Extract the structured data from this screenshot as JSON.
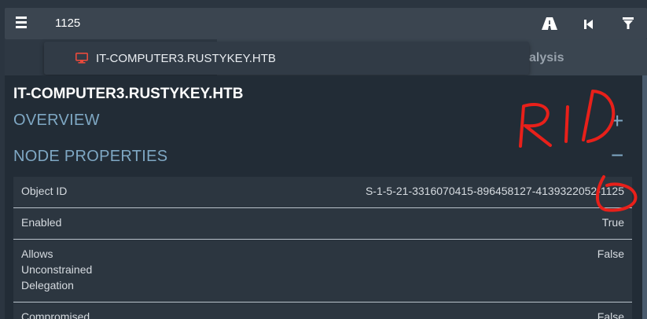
{
  "search": {
    "value": "1125"
  },
  "toolbar": {
    "icons": [
      "menu-icon",
      "road-icon",
      "skip-back-icon",
      "filter-icon"
    ]
  },
  "tabs": {
    "partial_label": "alysis"
  },
  "dropdown": {
    "icon": "computer-icon",
    "label": "IT-COMPUTER3.RUSTYKEY.HTB",
    "icon_color": "#e84a3c"
  },
  "node": {
    "title": "IT-COMPUTER3.RUSTYKEY.HTB"
  },
  "sections": {
    "overview": "OVERVIEW",
    "overview_toggle": "+",
    "node_properties": "NODE PROPERTIES",
    "node_properties_toggle": "−"
  },
  "properties": [
    {
      "label": "Object ID",
      "value": "S-1-5-21-3316070415-896458127-4139322052-1125"
    },
    {
      "label": "Enabled",
      "value": "True"
    },
    {
      "label": "Allows Unconstrained Delegation",
      "value": "False"
    },
    {
      "label": "Compromised",
      "value": "False"
    }
  ],
  "annotation": {
    "text": "RID",
    "color": "#e8201a"
  },
  "colors": {
    "background": "#2b3540",
    "panel": "#222c36",
    "section_text": "#7fa8c4"
  }
}
